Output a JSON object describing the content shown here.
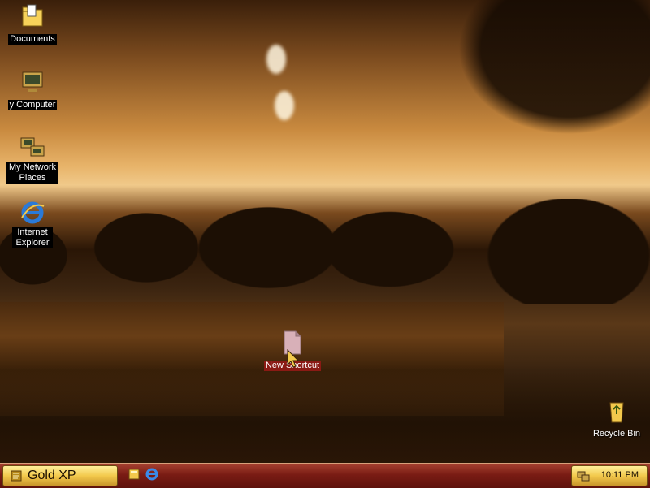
{
  "desktop": {
    "icons": [
      {
        "label": "Documents"
      },
      {
        "label": "y Computer"
      },
      {
        "label": "My Network Places"
      },
      {
        "label": "Internet Explorer"
      },
      {
        "label": "New Shortcut"
      },
      {
        "label": "Recycle Bin"
      }
    ]
  },
  "taskbar": {
    "start_label": "Gold XP",
    "quick_launch": [
      "show-desktop-icon",
      "internet-explorer-icon"
    ],
    "clock": "10:11 PM"
  },
  "colors": {
    "taskbar": "#7a1c14",
    "start_button": "#f3c94c"
  }
}
